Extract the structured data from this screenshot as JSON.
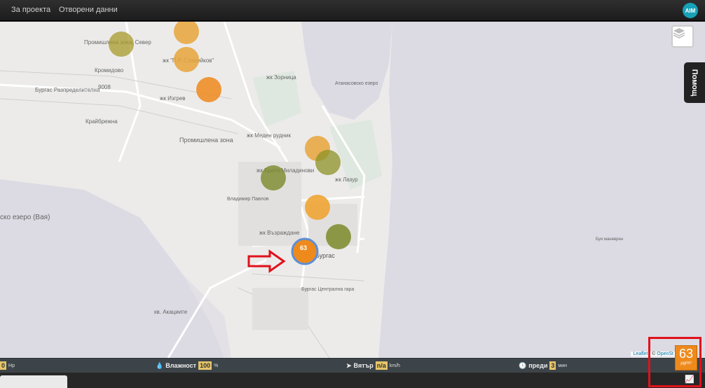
{
  "nav": {
    "about": "За проекта",
    "open_data": "Отворени данни",
    "logo_text": "AIM"
  },
  "map": {
    "labels": {
      "industrial_zone_n": "Промишлена зона, Север",
      "slaveykov": "жк \"П.Р. Славейков\"",
      "kromidovo": "Кромидово",
      "izgrev": "жк Изгрев",
      "zornitsa": "жк Зорница",
      "distributor": "Бургас Разпределителна",
      "station_label": "9008",
      "kraybrezhna": "Крайбрежна",
      "industrial_zone": "Промишлена зона",
      "lake": "Атанасовско езеро",
      "meden_rudnik": "жк Меден рудник",
      "lazur": "жк Лазур",
      "miladinovi": "жк Братя Миладинови",
      "vladimir_pavlov": "Владимир Павлов",
      "vazrazhdane": "жк Възраждане",
      "burgas": "Бургас",
      "burgas_central": "Бургас Централна гара",
      "akatsiite": "кв. Акациите",
      "vaya_lake": "ско езеро (Вая)",
      "sea_label": "Буи маневрен"
    },
    "cluster_value": "63"
  },
  "help_tab": "Помощ",
  "attribution": {
    "leaflet": "Leaflet",
    "sep": " | © ",
    "osm": "OpenSt"
  },
  "bottom": {
    "pressure": {
      "value": "0",
      "unit": "Hp"
    },
    "humidity": {
      "label": "Влажност",
      "value": "100",
      "unit": "%"
    },
    "wind": {
      "label": "Вятър",
      "value": "n/a",
      "unit": "km/h"
    },
    "updated": {
      "label": "преди",
      "value": "3",
      "unit": "мин"
    }
  },
  "aqi": {
    "value": "63",
    "unit": "µg/m³"
  },
  "colors": {
    "orange": "#ee8a1c",
    "amber": "#e8a53a",
    "olive": "#7d8a2a"
  },
  "icons": [
    "layers-icon",
    "droplet-icon",
    "send-icon",
    "clock-icon",
    "chart-icon"
  ]
}
